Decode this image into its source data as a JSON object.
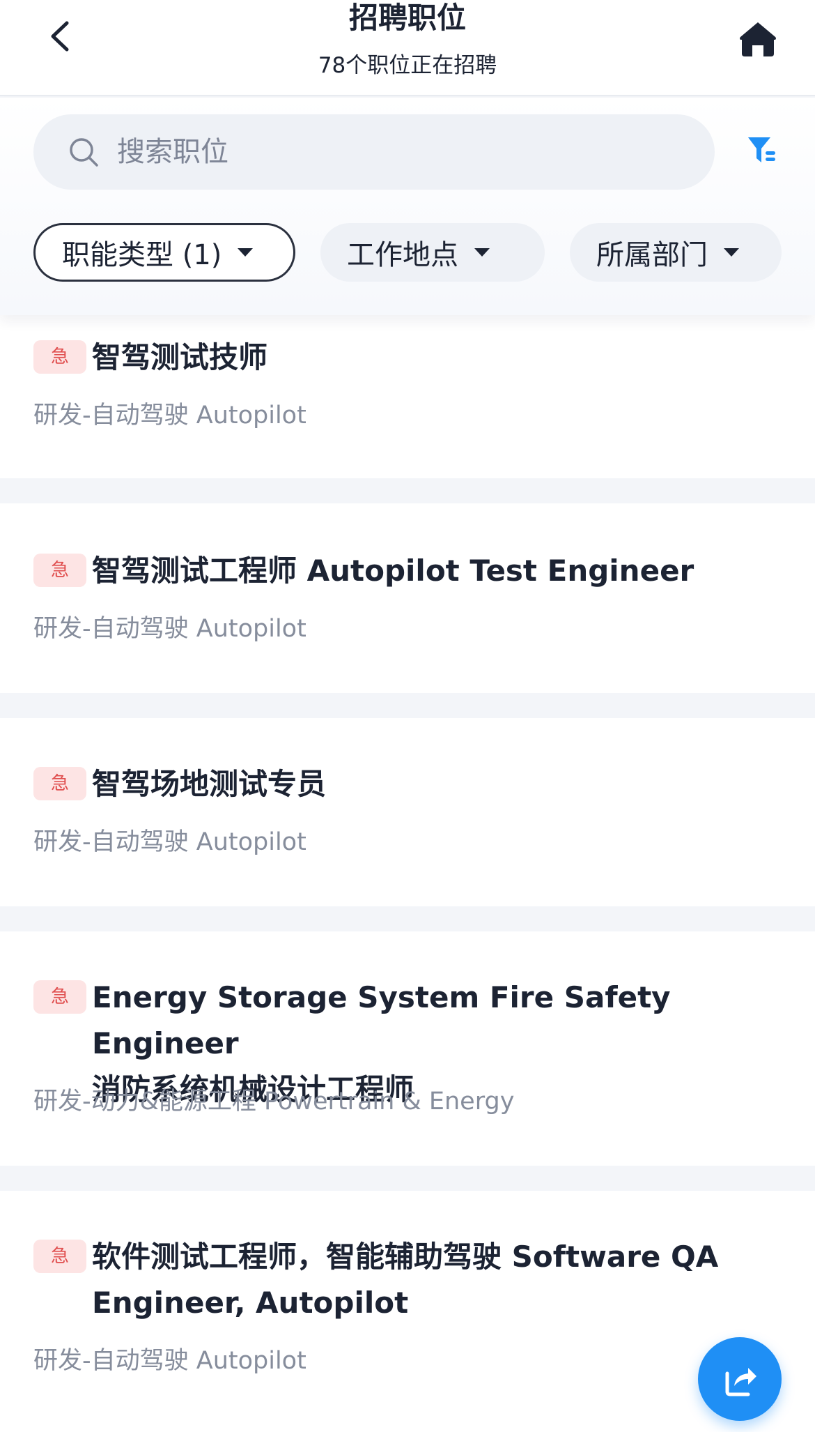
{
  "header": {
    "title": "招聘职位",
    "subtitle": "78个职位正在招聘",
    "back_icon": "chevron-left-icon",
    "home_icon": "home-icon"
  },
  "search": {
    "placeholder": "搜索职位",
    "value": "",
    "icon": "search-icon"
  },
  "filter_icon": "filter-icon",
  "filters": [
    {
      "label": "职能类型 (1)",
      "active": true
    },
    {
      "label": "工作地点",
      "active": false
    },
    {
      "label": "所属部门",
      "active": false
    }
  ],
  "jobs": [
    {
      "badge": "急",
      "title": "智驾测试技师",
      "department": "研发-自动驾驶 Autopilot"
    },
    {
      "badge": "急",
      "title": "智驾测试工程师 Autopilot Test Engineer",
      "department": "研发-自动驾驶 Autopilot"
    },
    {
      "badge": "急",
      "title": "智驾场地测试专员",
      "department": "研发-自动驾驶 Autopilot"
    },
    {
      "badge": "急",
      "title_lines": [
        "Energy Storage System Fire Safety Engineer",
        "消防系统机械设计工程师"
      ],
      "department": "研发-动力&能源工程 Powertrain & Energy"
    },
    {
      "badge": "急",
      "title_lines": [
        "软件测试工程师，智能辅助驾驶 Software QA",
        "Engineer, Autopilot"
      ],
      "department": "研发-自动驾驶 Autopilot"
    }
  ],
  "share_icon": "share-icon",
  "colors": {
    "accent": "#1f8ff5",
    "urgent_text": "#e04e4e",
    "urgent_bg": "#fde4e4",
    "title_text": "#1c2333",
    "secondary_text": "#868d9c",
    "page_bg": "#f3f5f9"
  }
}
